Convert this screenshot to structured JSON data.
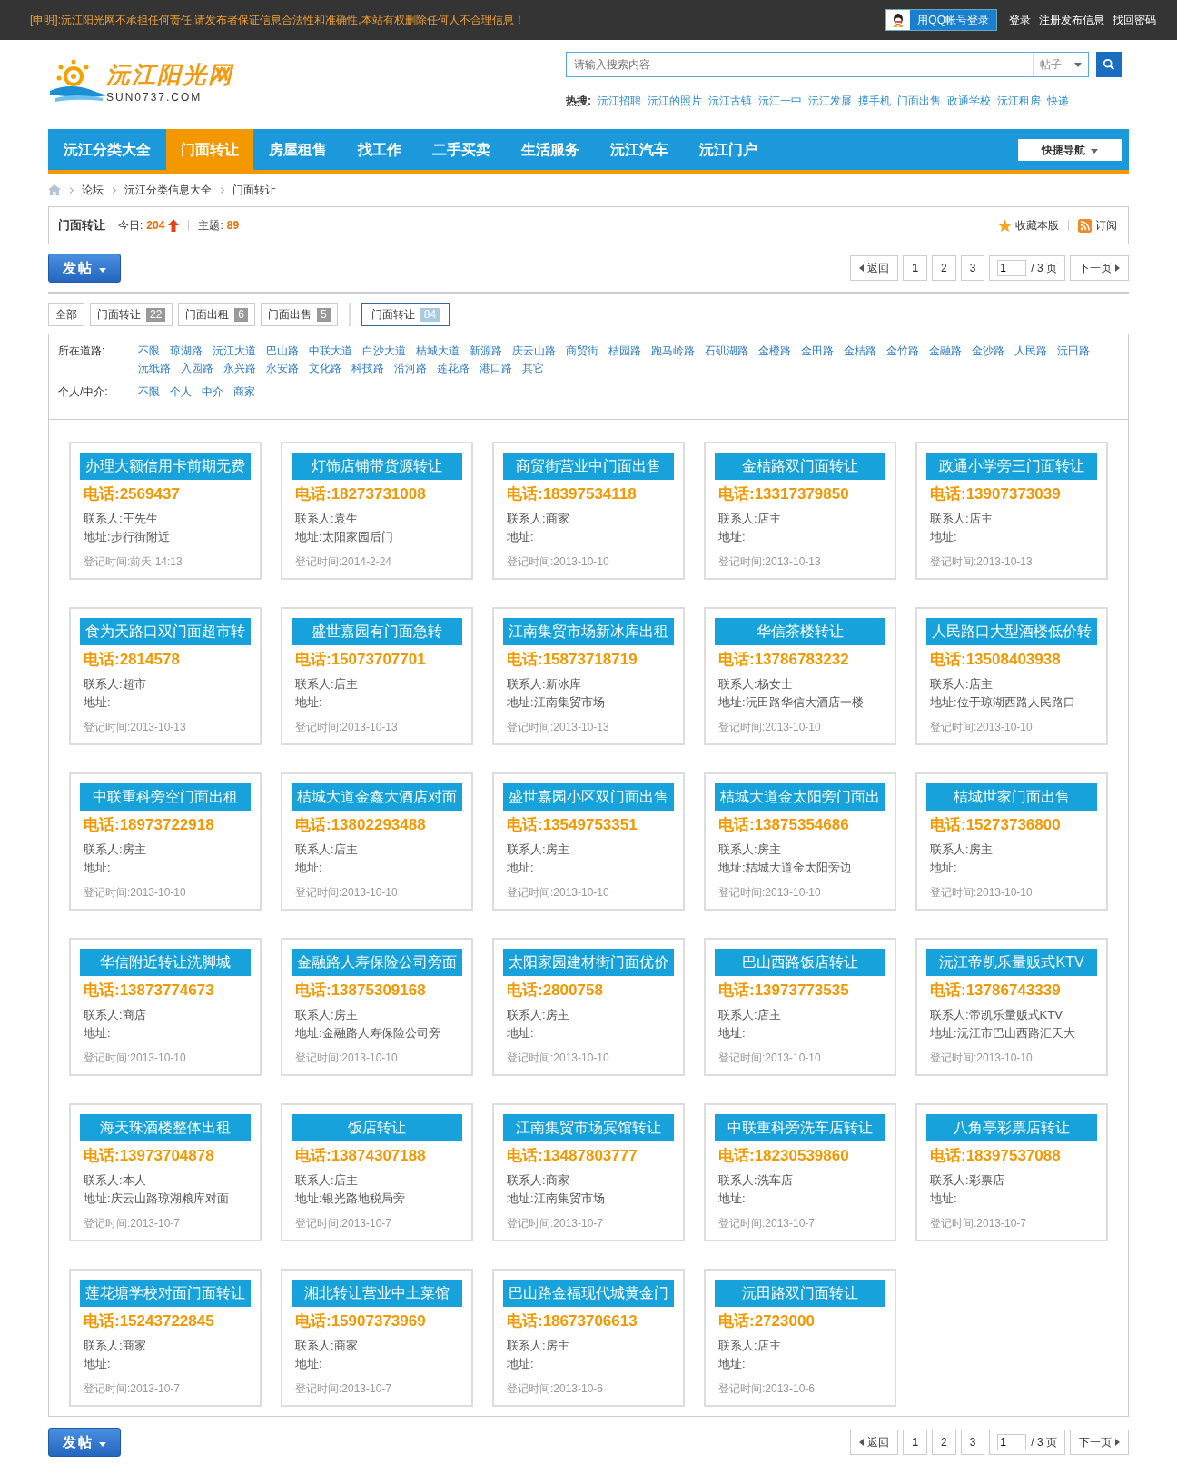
{
  "topbar": {
    "notice": "[申明]:沅江阳光网不承担任何责任,请发布者保证信息合法性和准确性,本站有权删除任何人不合理信息！",
    "qq_login": "用QQ帐号登录",
    "links": [
      "登录",
      "注册发布信息",
      "找回密码"
    ]
  },
  "logo": {
    "name": "沅江阳光网",
    "domain": "SUN0737.COM"
  },
  "search": {
    "placeholder": "请输入搜索内容",
    "scope": "帖子",
    "hot_label": "热搜:",
    "hot": [
      "沅江招聘",
      "沅江的照片",
      "沅江古镇",
      "沅江一中",
      "沅江发展",
      "摸手机",
      "门面出售",
      "政通学校",
      "沅江租房",
      "快递"
    ]
  },
  "nav": {
    "items": [
      {
        "label": "沅江分类大全",
        "selected": false
      },
      {
        "label": "门面转让",
        "selected": true
      },
      {
        "label": "房屋租售",
        "selected": false
      },
      {
        "label": "找工作",
        "selected": false
      },
      {
        "label": "二手买卖",
        "selected": false
      },
      {
        "label": "生活服务",
        "selected": false
      },
      {
        "label": "沅江汽车",
        "selected": false
      },
      {
        "label": "沅江门户",
        "selected": false
      }
    ],
    "quick": "快捷导航"
  },
  "breadcrumb": [
    "论坛",
    "沅江分类信息大全",
    "门面转让"
  ],
  "forum": {
    "title": "门面转让",
    "today_label": "今日:",
    "today": "204",
    "topics_label": "主题:",
    "topics": "89",
    "favorite": "收藏本版",
    "subscribe": "订阅"
  },
  "action_bars": [
    {
      "post_button": "发帖",
      "pager": {
        "back": "返回",
        "pages": [
          {
            "label": "1",
            "selected": true
          },
          {
            "label": "2",
            "selected": false
          },
          {
            "label": "3",
            "selected": false
          }
        ],
        "input": "1",
        "total": "/ 3 页",
        "next": "下一页"
      }
    },
    {
      "post_button": "发帖",
      "pager": {
        "back": "返回",
        "pages": [
          {
            "label": "1",
            "selected": true
          },
          {
            "label": "2",
            "selected": false
          },
          {
            "label": "3",
            "selected": false
          }
        ],
        "input": "1",
        "total": "/ 3 页",
        "next": "下一页"
      }
    }
  ],
  "tabs": [
    {
      "label": "全部",
      "selected": false
    },
    {
      "label": "门面转让",
      "count": "22",
      "selected": false
    },
    {
      "label": "门面出租",
      "count": "6",
      "selected": false
    },
    {
      "label": "门面出售",
      "count": "5",
      "selected": false
    },
    {
      "label": "门面转让",
      "count": "84",
      "selected": true
    }
  ],
  "filters": [
    {
      "label": "所在道路:",
      "options": [
        "不限",
        "琼湖路",
        "沅江大道",
        "巴山路",
        "中联大道",
        "白沙大道",
        "桔城大道",
        "新源路",
        "庆云山路",
        "商贸街",
        "桔园路",
        "跑马岭路",
        "石矶湖路",
        "金橙路",
        "金田路",
        "金桔路",
        "金竹路",
        "金融路",
        "金沙路",
        "人民路",
        "沅田路",
        "沅纸路",
        "入园路",
        "永兴路",
        "永安路",
        "文化路",
        "科技路",
        "沿河路",
        "莲花路",
        "港口路",
        "其它"
      ]
    },
    {
      "label": "个人/中介:",
      "options": [
        "不限",
        "个人",
        "中介",
        "商家"
      ]
    }
  ],
  "cards": [
    {
      "title": "办理大额信用卡前期无费",
      "phone": "电话:2569437",
      "contact": "联系人:王先生",
      "address": "地址:步行街附近",
      "date": "登记时间:前天 14:13"
    },
    {
      "title": "灯饰店铺带货源转让",
      "phone": "电话:18273731008",
      "contact": "联系人:袁生",
      "address": "地址:太阳家园后门",
      "date": "登记时间:2014-2-24"
    },
    {
      "title": "商贸街营业中门面出售",
      "phone": "电话:18397534118",
      "contact": "联系人:商家",
      "address": "地址:",
      "date": "登记时间:2013-10-10"
    },
    {
      "title": "金桔路双门面转让",
      "phone": "电话:13317379850",
      "contact": "联系人:店主",
      "address": "地址:",
      "date": "登记时间:2013-10-13"
    },
    {
      "title": "政通小学旁三门面转让",
      "phone": "电话:13907373039",
      "contact": "联系人:店主",
      "address": "地址:",
      "date": "登记时间:2013-10-13"
    },
    {
      "title": "食为天路口双门面超市转",
      "phone": "电话:2814578",
      "contact": "联系人:超市",
      "address": "地址:",
      "date": "登记时间:2013-10-13"
    },
    {
      "title": "盛世嘉园有门面急转",
      "phone": "电话:15073707701",
      "contact": "联系人:店主",
      "address": "地址:",
      "date": "登记时间:2013-10-13"
    },
    {
      "title": "江南集贸市场新冰库出租",
      "phone": "电话:15873718719",
      "contact": "联系人:新冰库",
      "address": "地址:江南集贸市场",
      "date": "登记时间:2013-10-13"
    },
    {
      "title": "华信茶楼转让",
      "phone": "电话:13786783232",
      "contact": "联系人:杨女士",
      "address": "地址:沅田路华信大酒店一楼",
      "date": "登记时间:2013-10-10"
    },
    {
      "title": "人民路口大型酒楼低价转",
      "phone": "电话:13508403938",
      "contact": "联系人:店主",
      "address": "地址:位于琼湖西路人民路口",
      "date": "登记时间:2013-10-10"
    },
    {
      "title": "中联重科旁空门面出租",
      "phone": "电话:18973722918",
      "contact": "联系人:房主",
      "address": "地址:",
      "date": "登记时间:2013-10-10"
    },
    {
      "title": "桔城大道金鑫大酒店对面",
      "phone": "电话:13802293488",
      "contact": "联系人:店主",
      "address": "地址:",
      "date": "登记时间:2013-10-10"
    },
    {
      "title": "盛世嘉园小区双门面出售",
      "phone": "电话:13549753351",
      "contact": "联系人:房主",
      "address": "地址:",
      "date": "登记时间:2013-10-10"
    },
    {
      "title": "桔城大道金太阳旁门面出",
      "phone": "电话:13875354686",
      "contact": "联系人:房主",
      "address": "地址:桔城大道金太阳旁边",
      "date": "登记时间:2013-10-10"
    },
    {
      "title": "桔城世家门面出售",
      "phone": "电话:15273736800",
      "contact": "联系人:房主",
      "address": "地址:",
      "date": "登记时间:2013-10-10"
    },
    {
      "title": "华信附近转让洗脚城",
      "phone": "电话:13873774673",
      "contact": "联系人:商店",
      "address": "地址:",
      "date": "登记时间:2013-10-10"
    },
    {
      "title": "金融路人寿保险公司旁面",
      "phone": "电话:13875309168",
      "contact": "联系人:房主",
      "address": "地址:金融路人寿保险公司旁",
      "date": "登记时间:2013-10-10"
    },
    {
      "title": "太阳家园建材街门面优价",
      "phone": "电话:2800758",
      "contact": "联系人:房主",
      "address": "地址:",
      "date": "登记时间:2013-10-10"
    },
    {
      "title": "巴山西路饭店转让",
      "phone": "电话:13973773535",
      "contact": "联系人:店主",
      "address": "地址:",
      "date": "登记时间:2013-10-10"
    },
    {
      "title": "沅江帝凯乐量贩式KTV",
      "phone": "电话:13786743339",
      "contact": "联系人:帝凯乐量贩式KTV",
      "address": "地址:沅江市巴山西路汇天大",
      "date": "登记时间:2013-10-10"
    },
    {
      "title": "海天珠酒楼整体出租",
      "phone": "电话:13973704878",
      "contact": "联系人:本人",
      "address": "地址:庆云山路琼湖粮库对面",
      "date": "登记时间:2013-10-7"
    },
    {
      "title": "饭店转让",
      "phone": "电话:13874307188",
      "contact": "联系人:店主",
      "address": "地址:银光路地税局旁",
      "date": "登记时间:2013-10-7"
    },
    {
      "title": "江南集贸市场宾馆转让",
      "phone": "电话:13487803777",
      "contact": "联系人:商家",
      "address": "地址:江南集贸市场",
      "date": "登记时间:2013-10-7"
    },
    {
      "title": "中联重科旁洗车店转让",
      "phone": "电话:18230539860",
      "contact": "联系人:洗车店",
      "address": "地址:",
      "date": "登记时间:2013-10-7"
    },
    {
      "title": "八角亭彩票店转让",
      "phone": "电话:18397537088",
      "contact": "联系人:彩票店",
      "address": "地址:",
      "date": "登记时间:2013-10-7"
    },
    {
      "title": "莲花塘学校对面门面转让",
      "phone": "电话:15243722845",
      "contact": "联系人:商家",
      "address": "地址:",
      "date": "登记时间:2013-10-7"
    },
    {
      "title": "湘北转让营业中土菜馆",
      "phone": "电话:15907373969",
      "contact": "联系人:商家",
      "address": "地址:",
      "date": "登记时间:2013-10-7"
    },
    {
      "title": "巴山路金福现代城黄金门",
      "phone": "电话:18673706613",
      "contact": "联系人:房主",
      "address": "地址:",
      "date": "登记时间:2013-10-6"
    },
    {
      "title": "沅田路双门面转让",
      "phone": "电话:2723000",
      "contact": "联系人:店主",
      "address": "地址:",
      "date": "登记时间:2013-10-6"
    }
  ]
}
